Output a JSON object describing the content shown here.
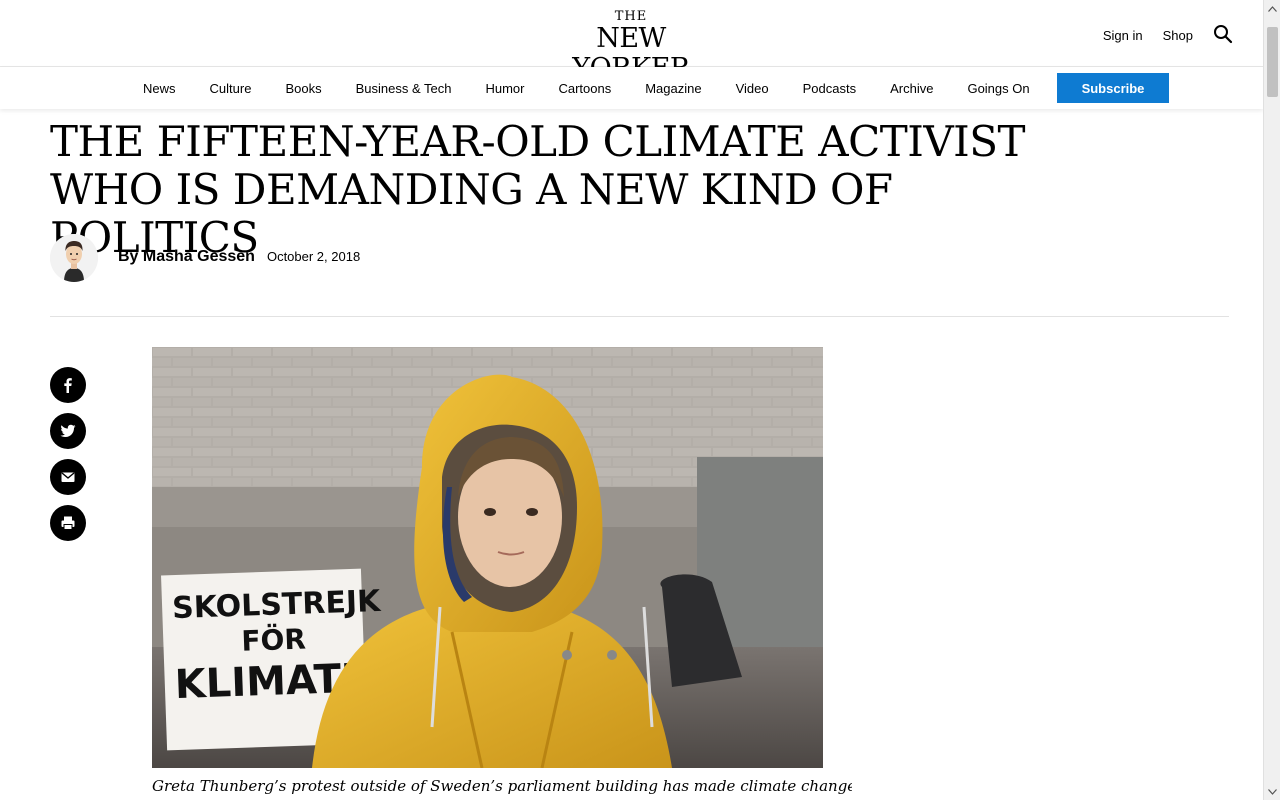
{
  "header": {
    "logo_top": "THE",
    "logo_name": "NEW YORKER",
    "sign_in": "Sign in",
    "shop": "Shop",
    "search_icon": "search-icon"
  },
  "nav": {
    "items": [
      "News",
      "Culture",
      "Books",
      "Business & Tech",
      "Humor",
      "Cartoons",
      "Magazine",
      "Video",
      "Podcasts",
      "Archive",
      "Goings On"
    ],
    "subscribe": "Subscribe"
  },
  "article": {
    "headline_line1": "THE FIFTEEN-YEAR-OLD CLIMATE ACTIVIST",
    "headline_line2": "WHO IS DEMANDING A NEW KIND OF POLITICS",
    "byline": "By Masha Gessen",
    "date": "October 2, 2018",
    "sign_text": [
      "SKOLSTREJK",
      "FÖR",
      "KLIMATET"
    ],
    "caption": "Greta Thunberg’s protest outside of Sweden’s parliament building has made climate change a topic of"
  },
  "social": [
    "facebook-icon",
    "twitter-icon",
    "email-icon",
    "print-icon"
  ],
  "colors": {
    "subscribe_bg": "#0e7bd2",
    "raincoat": "#e8b62a"
  }
}
